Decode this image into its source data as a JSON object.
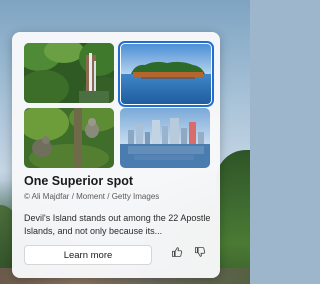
{
  "card": {
    "title": "One Superior spot",
    "credit": "© Ali Majdfar / Moment / Getty Images",
    "description": "Devil's Island stands out among the 22 Apostle Islands, and not only because its...",
    "learn_more_label": "Learn more",
    "icons": {
      "like": "thumbs-up-icon",
      "dislike": "thumbs-down-icon"
    },
    "thumbnails": [
      {
        "name": "waterfall-forest-thumbnail",
        "selected": false
      },
      {
        "name": "island-lake-thumbnail",
        "selected": true
      },
      {
        "name": "monkey-forest-thumbnail",
        "selected": false
      },
      {
        "name": "city-skyline-thumbnail",
        "selected": false
      }
    ]
  },
  "colors": {
    "accent": "#1f6fd1",
    "card_background": "#f8f8fa"
  }
}
